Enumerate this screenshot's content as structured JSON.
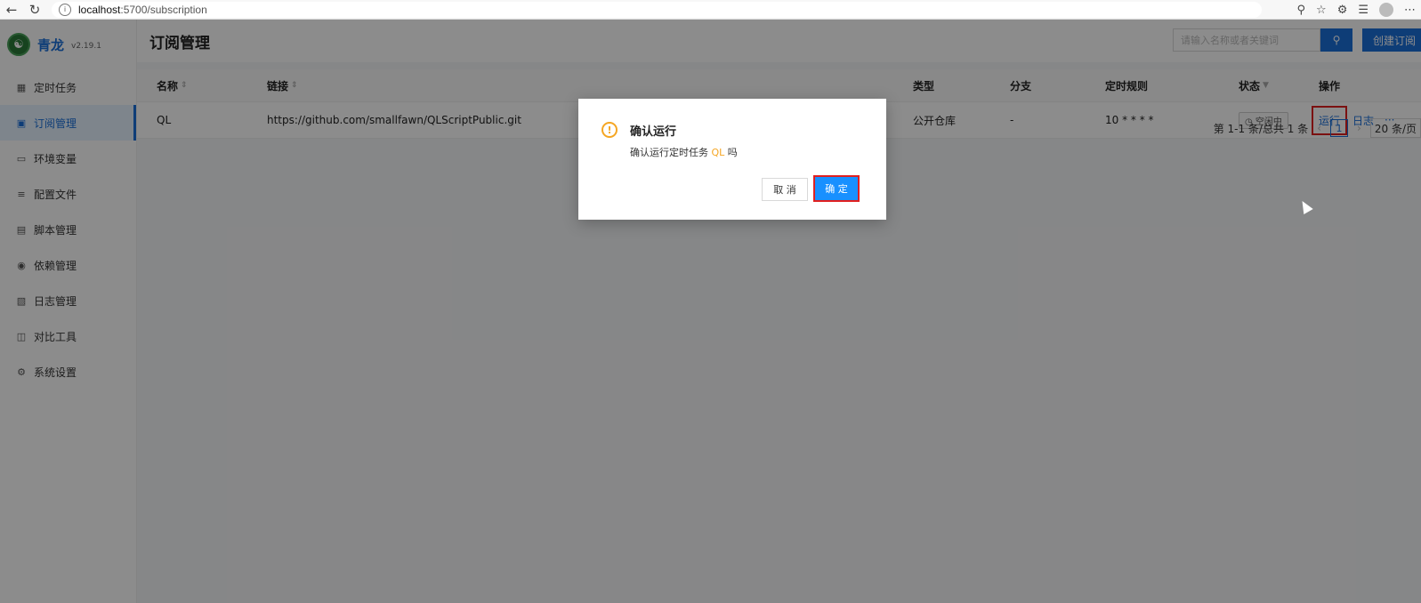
{
  "browser": {
    "url_host": "localhost",
    "url_path": ":5700/subscription",
    "info_icon": "i"
  },
  "sidebar": {
    "brand_name": "青龙",
    "brand_version": "v2.19.1",
    "items": [
      {
        "label": "定时任务",
        "icon": "calendar-icon"
      },
      {
        "label": "订阅管理",
        "icon": "subscription-icon",
        "active": true
      },
      {
        "label": "环境变量",
        "icon": "monitor-icon"
      },
      {
        "label": "配置文件",
        "icon": "sliders-icon"
      },
      {
        "label": "脚本管理",
        "icon": "script-icon"
      },
      {
        "label": "依赖管理",
        "icon": "dependency-icon"
      },
      {
        "label": "日志管理",
        "icon": "log-icon"
      },
      {
        "label": "对比工具",
        "icon": "diff-icon"
      },
      {
        "label": "系统设置",
        "icon": "gear-icon"
      }
    ]
  },
  "header": {
    "title": "订阅管理",
    "search_placeholder": "请输入名称或者关键词",
    "create_label": "创建订阅"
  },
  "table": {
    "columns": [
      "名称",
      "链接",
      "类型",
      "分支",
      "定时规则",
      "状态",
      "操作"
    ],
    "rows": [
      {
        "name": "QL",
        "link": "https://github.com/smallfawn/QLScriptPublic.git",
        "type": "公开仓库",
        "branch": "-",
        "schedule": "10 * * * *",
        "status": "空闲中",
        "op_run": "运行",
        "op_log": "日志",
        "op_more": "···"
      }
    ]
  },
  "pagination": {
    "summary": "第 1-1 条/总共 1 条",
    "current_page": "1",
    "page_size": "20 条/页"
  },
  "modal": {
    "title": "确认运行",
    "content_prefix": "确认运行定时任务 ",
    "content_highlight": "QL",
    "content_suffix": " 吗",
    "cancel_label": "取 消",
    "ok_label": "确 定",
    "warn_icon": "!"
  },
  "colors": {
    "accent": "#1a6fd9",
    "warning": "#f5a623",
    "highlight_border": "#e02020"
  }
}
